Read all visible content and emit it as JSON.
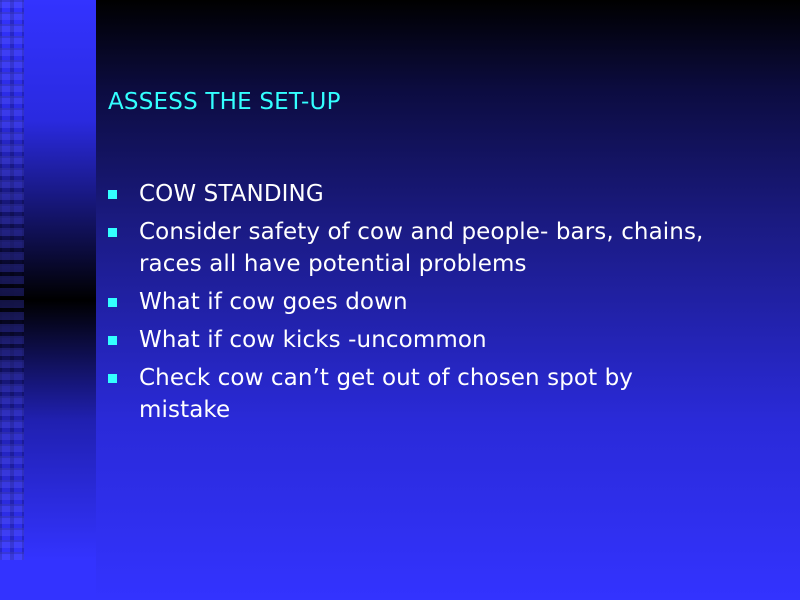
{
  "slide": {
    "title": "ASSESS THE SET-UP",
    "bullets": [
      "COW STANDING",
      "Consider safety of cow and people- bars, chains, races all have potential problems",
      "What if cow goes down",
      "What if cow kicks -uncommon",
      "Check cow can’t get out of chosen spot by mistake"
    ]
  }
}
